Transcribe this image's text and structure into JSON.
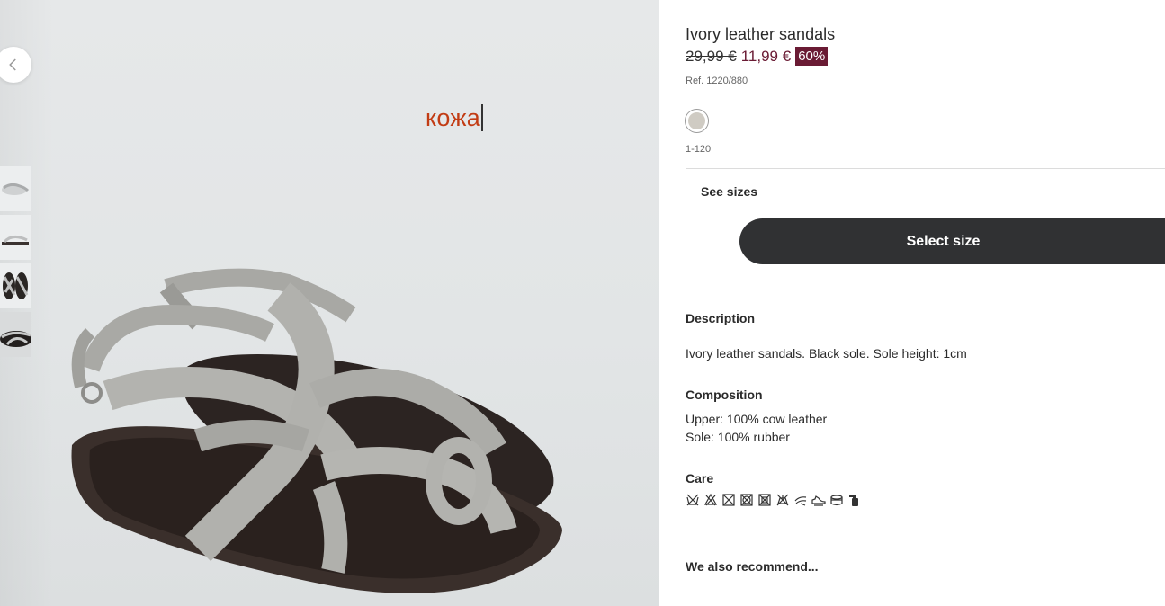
{
  "gallery": {
    "prev_icon": "chevron-left-icon",
    "overlay_word": "кожа",
    "thumbnails": [
      "thumb-sandal-top",
      "thumb-sandal-side",
      "thumb-sandal-pair",
      "thumb-sandal-model"
    ]
  },
  "product": {
    "title": "Ivory leather sandals",
    "old_price": "29,99 €",
    "new_price": "11,99 €",
    "discount": "60%",
    "ref": "Ref. 1220/880",
    "color_code": "1-120",
    "colors": {
      "swatch": "#cfcbc3",
      "accent": "#6a1b34",
      "button": "#303133"
    }
  },
  "actions": {
    "see_sizes": "See sizes",
    "select_size": "Select size"
  },
  "description": {
    "title": "Description",
    "text": "Ivory leather sandals. Black sole. Sole height: 1cm"
  },
  "composition": {
    "title": "Composition",
    "upper": "Upper: 100% cow leather",
    "sole": "Sole: 100% rubber"
  },
  "care": {
    "title": "Care",
    "icons": [
      "no-wash-icon",
      "no-bleach-icon",
      "no-tumble-dry-icon",
      "no-dry-icon",
      "no-iron-icon",
      "no-dry-clean-icon",
      "wipe-clean-icon",
      "shoe-care-icon",
      "cream-icon",
      "spray-icon"
    ]
  },
  "recommend": {
    "title": "We also recommend..."
  }
}
